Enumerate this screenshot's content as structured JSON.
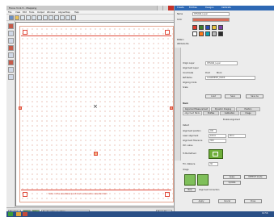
{
  "window": {
    "title": "Fiona 3.11.5 - Mapping"
  },
  "menu": {
    "items": [
      "File",
      "View",
      "Edit",
      "Tools",
      "Output",
      "Window",
      "AlignerMap",
      "Help"
    ]
  },
  "right_menu": {
    "items": [
      "Create",
      "Entities",
      "Designs",
      "Calibrate"
    ]
  },
  "toolbar": {
    "icons": [
      "new-icon",
      "open-icon",
      "save-icon",
      "print-icon",
      "grid-icon",
      "cut-icon",
      "copy-icon",
      "paste-icon",
      "select-icon",
      "zoom-icon",
      "hand-icon",
      "help-icon"
    ]
  },
  "canvas": {
    "bottom_note": "Note: In the selectable point mark will position selected item",
    "marker": "×"
  },
  "statusbar": {
    "zoom_label": "No Area",
    "coord1": "0.0",
    "coord2": "0.0",
    "status_text": "Enabled  Manipulation",
    "mode": "Move All"
  },
  "panel": {
    "title": "Fiona 3.11.5 - Layer",
    "name_label": "Name",
    "name_value": "DESIGN_Layer",
    "color_label": "Color",
    "pattern_label": "Pattern",
    "attribute_label": "Attribute No.",
    "layer_color_hex": "#d76e5a",
    "swatches": [
      "#e23c2e",
      "#3a7d2c",
      "#2a4ab4",
      "#e7c23a",
      "#7a3fa6",
      "#ffffff",
      "#ff7a1a",
      "#0aa3b1",
      "#bbbbbb",
      "#2b2b2b"
    ],
    "section1": {
      "r1_label": "Origin Layer",
      "r1_value": "DESIGN_Layer",
      "r2_label": "Alignment Layer",
      "r3_label": "Coordinate",
      "r3_opt1": "Point",
      "r3_opt2": "Block",
      "r4_label": "Ref Name",
      "r4_value": "ALIGNMENT_MARK",
      "r5_label": "Aligning mode",
      "r6_label": "Scale",
      "btn_load": "Load",
      "btn_save": "Save",
      "btn_saveas": "Save As"
    },
    "section2_label": "Mark",
    "tabs": [
      "Alignment Measurement",
      "Dynamic Imaging",
      "Position"
    ],
    "tabs2": [
      "Alignment Marks",
      "Profiles",
      "Calibration",
      "Image"
    ],
    "checkbox_label": "Enable alignment",
    "fields": [
      {
        "label": "Detect",
        "value": ""
      },
      {
        "label": "Alignment position",
        "value": "ON"
      },
      {
        "label": "Laser alignment",
        "value": "100.0"
      },
      {
        "label": "Alignment Tolerance",
        "value": "300"
      },
      {
        "label": "Ctrl. value",
        "value": ""
      }
    ],
    "field_extra": "MCU",
    "tolerance_label": "To Be Defined",
    "thr_label": "Thr. distance",
    "thr_value": "30",
    "image_label": "Image",
    "btn_apply": "Apply",
    "btn_detect": "DETECT mode",
    "btn_update": "Update",
    "btn_new": "New",
    "align_check": "Alignment Correction",
    "bottom_buttons": [
      "Apply",
      "Cancel",
      "Close"
    ]
  },
  "taskbar": {
    "time": "10:56"
  }
}
